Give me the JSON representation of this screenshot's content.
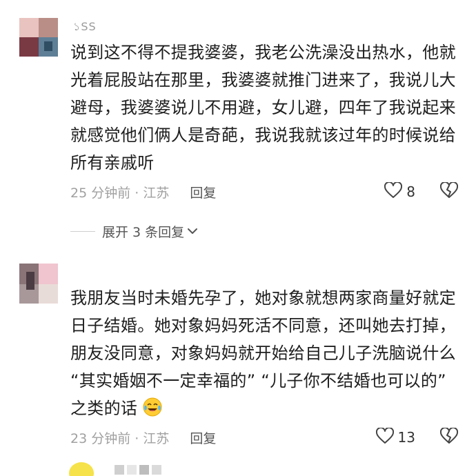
{
  "comments": [
    {
      "username": "১SS",
      "text_lines": [
        "说到这不得不提我婆婆，我老公洗澡没出热水，他就",
        "光着屁股站在那里，我婆婆就推门进来了，我说儿大",
        "避母，我婆婆说儿不用避，女儿避，四年了我说起来",
        "就感觉他们俩人是奇葩，我说我就该过年的时候说给",
        "所有亲戚听"
      ],
      "time_location": "25 分钟前 · 江苏",
      "reply_label": "回复",
      "like_count": "8",
      "expand_label": "展开 3 条回复"
    },
    {
      "text_lines": [
        "我朋友当时未婚先孕了，她对象就想两家商量好就定",
        "日子结婚。她对象妈妈死活不同意，还叫她去打掉，",
        "朋友没同意，对象妈妈就开始给自己儿子洗脑说什么",
        "“其实婚姻不一定幸福的” “儿子你不结婚也可以的”",
        "之类的话"
      ],
      "emoji": "crying-laughing-emoji",
      "time_location": "23 分钟前 · 江苏",
      "reply_label": "回复",
      "like_count": "13"
    }
  ],
  "colors": {
    "text": "#1e1e1e",
    "meta": "#a0a0a0",
    "reply": "#555555"
  }
}
